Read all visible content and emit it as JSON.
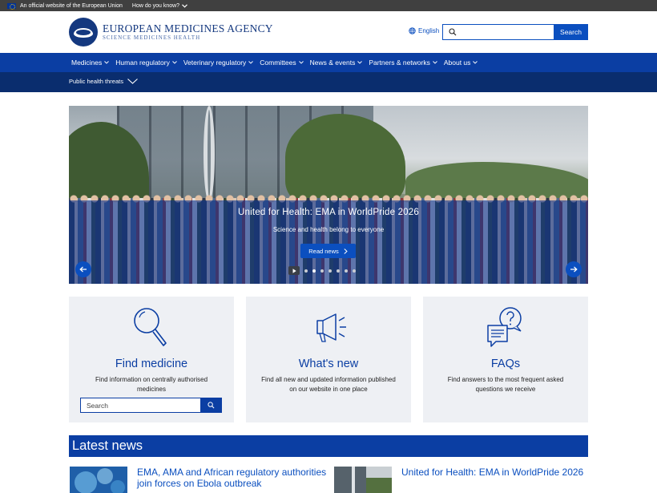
{
  "eu_banner": {
    "official_text": "An official website of the European Union",
    "how_text": "How do you know?"
  },
  "header": {
    "agency_name": "EUROPEAN MEDICINES AGENCY",
    "agency_tagline": "SCIENCE   MEDICINES   HEALTH",
    "language": "English",
    "search_placeholder": "",
    "search_button": "Search"
  },
  "nav": {
    "items": [
      {
        "label": "Medicines"
      },
      {
        "label": "Human regulatory"
      },
      {
        "label": "Veterinary regulatory"
      },
      {
        "label": "Committees"
      },
      {
        "label": "News & events"
      },
      {
        "label": "Partners & networks"
      },
      {
        "label": "About us"
      }
    ],
    "secondary": {
      "label": "Public health threats"
    }
  },
  "hero": {
    "title": "United for Health: EMA in WorldPride 2026",
    "subtitle": "Science and health belong to everyone",
    "button": "Read news",
    "slide_count": 7,
    "active_slide": 1
  },
  "cards": [
    {
      "title": "Find medicine",
      "description": "Find information on centrally authorised medicines",
      "search_placeholder": "Search",
      "icon": "magnifier-icon"
    },
    {
      "title": "What's new",
      "description": "Find all new and updated information published on our website in one place",
      "icon": "megaphone-icon"
    },
    {
      "title": "FAQs",
      "description": "Find answers to the most frequent asked questions we receive",
      "icon": "speech-bubbles-question-icon"
    }
  ],
  "latest_news": {
    "heading": "Latest news",
    "items": [
      {
        "title": "EMA, AMA and African regulatory authorities join forces on Ebola outbreak"
      },
      {
        "title": "United for Health: EMA in WorldPride 2026"
      }
    ]
  },
  "colors": {
    "primary_blue": "#0b3ea3",
    "link_blue": "#0b4fbf",
    "dark_navy": "#0a2d6e",
    "card_bg": "#eef0f4"
  }
}
